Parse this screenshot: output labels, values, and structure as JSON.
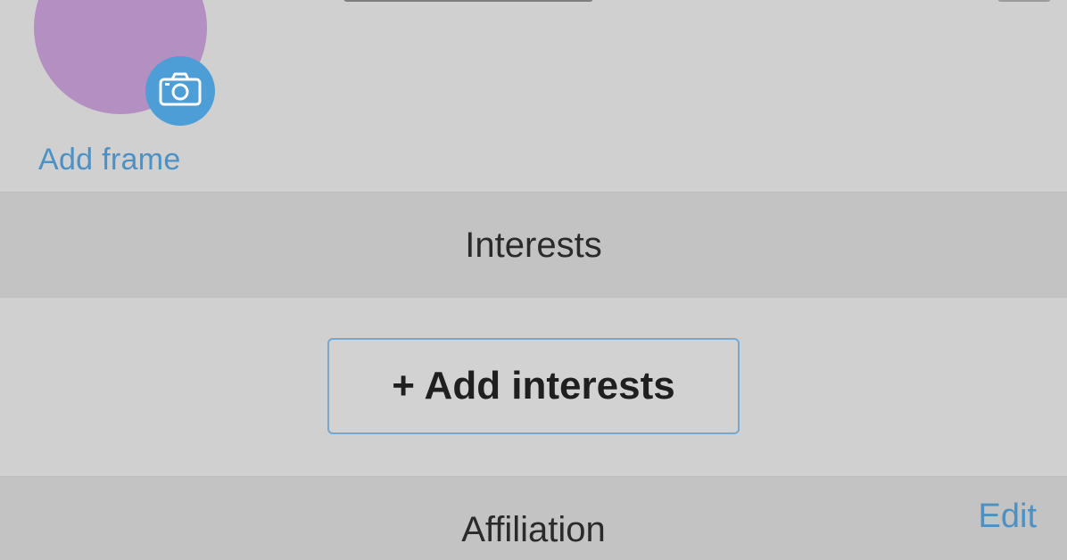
{
  "profile": {
    "add_frame_label": "Add frame",
    "avatar_color": "#b48fc2",
    "camera_badge_color": "#4d9dd6",
    "camera_icon": "camera-icon"
  },
  "sections": {
    "interests_title": "Interests",
    "add_interests_label": "+ Add interests",
    "affiliation_title": "Affiliation",
    "edit_label": "Edit"
  },
  "colors": {
    "background": "#d0d0d0",
    "section_header_bg": "#c3c3c3",
    "link_blue": "#4d90c4",
    "button_border": "#7aa6c9"
  }
}
